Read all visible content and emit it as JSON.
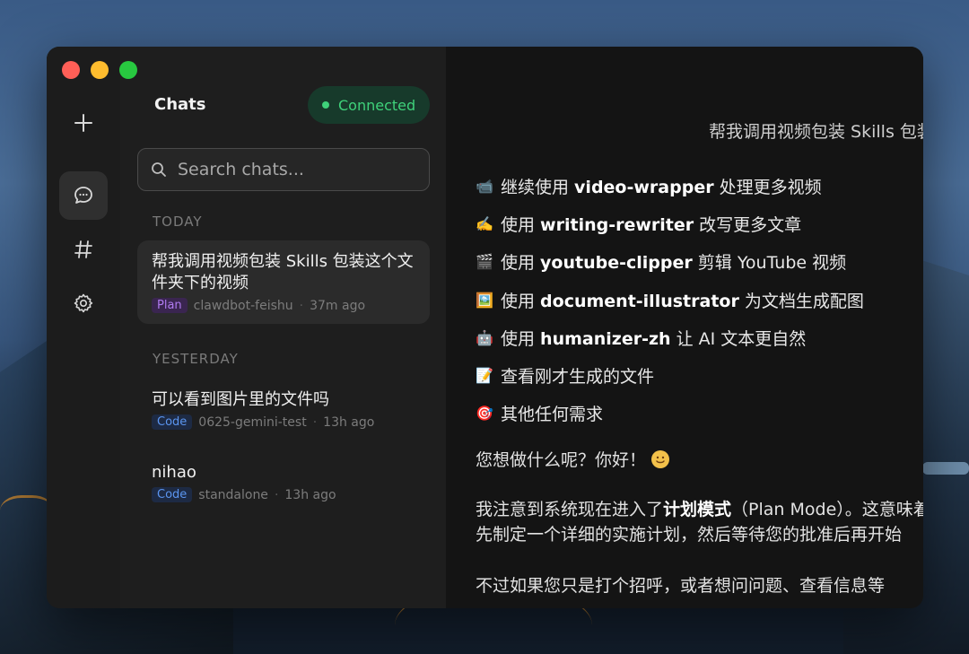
{
  "window": {
    "traffic_lights": {
      "close": "#ff5f57",
      "minimize": "#febc2e",
      "zoom": "#28c840"
    }
  },
  "rail": {
    "items": [
      {
        "icon": "plus-icon",
        "active": false
      },
      {
        "icon": "chat-bubble-icon",
        "active": true
      },
      {
        "icon": "hash-icon",
        "active": false
      },
      {
        "icon": "gear-icon",
        "active": false
      }
    ]
  },
  "sidebar": {
    "title": "Chats",
    "status": {
      "label": "Connected",
      "color": "#3fd17a"
    },
    "search": {
      "placeholder": "Search chats..."
    },
    "sections": [
      {
        "label": "TODAY",
        "chats": [
          {
            "title": "帮我调用视频包装 Skills 包装这个文件夹下的视频",
            "tag": "Plan",
            "source": "clawdbot-feishu",
            "time": "37m ago",
            "active": true
          }
        ]
      },
      {
        "label": "YESTERDAY",
        "chats": [
          {
            "title": "可以看到图片里的文件吗",
            "tag": "Code",
            "source": "0625-gemini-test",
            "time": "13h ago",
            "active": false
          },
          {
            "title": "nihao",
            "tag": "Code",
            "source": "standalone",
            "time": "13h ago",
            "active": false
          }
        ]
      }
    ]
  },
  "main": {
    "user_message": "帮我调用视频包装 Skills 包装这个文件夹下的视频",
    "options": [
      {
        "emoji": "📹",
        "prefix": "继续使用 ",
        "bold": "video-wrapper",
        "suffix": " 处理更多视频"
      },
      {
        "emoji": "✍️",
        "prefix": "使用 ",
        "bold": "writing-rewriter",
        "suffix": " 改写更多文章"
      },
      {
        "emoji": "🎬",
        "prefix": "使用 ",
        "bold": "youtube-clipper",
        "suffix": " 剪辑 YouTube 视频"
      },
      {
        "emoji": "🖼️",
        "prefix": "使用 ",
        "bold": "document-illustrator",
        "suffix": " 为文档生成配图"
      },
      {
        "emoji": "🤖",
        "prefix": "使用 ",
        "bold": "humanizer-zh",
        "suffix": " 让 AI 文本更自然"
      },
      {
        "emoji": "📝",
        "prefix": "查看刚才生成的文件",
        "bold": "",
        "suffix": ""
      },
      {
        "emoji": "🎯",
        "prefix": "其他任何需求",
        "bold": "",
        "suffix": ""
      }
    ],
    "question": "您想做什么呢？你好！",
    "plan_para": {
      "line1_prefix": "我注意到系统现在进入了",
      "line1_bold": "计划模式",
      "line1_suffix": "（Plan Mode）。这意味着",
      "line2": "先制定一个详细的实施计划，然后等待您的批准后再开始"
    },
    "last_para": "不过如果您只是打个招呼，或者想问问题、查看信息等"
  }
}
